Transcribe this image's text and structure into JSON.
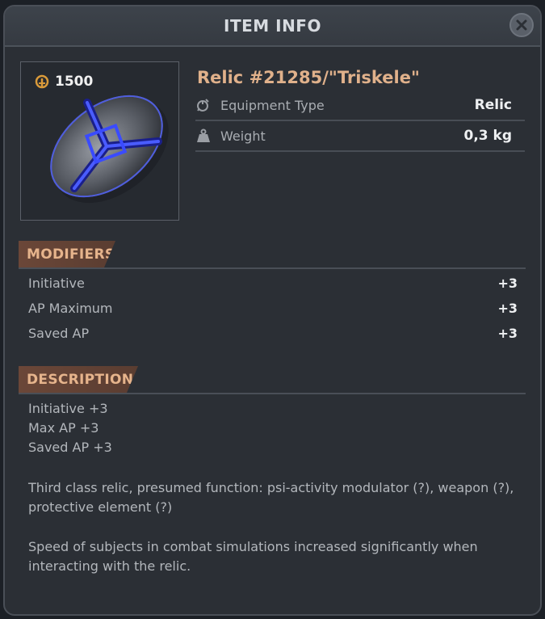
{
  "header": {
    "title": "ITEM INFO"
  },
  "item": {
    "price": "1500",
    "name": "Relic #21285/\"Triskele\"",
    "stats": [
      {
        "label": "Equipment Type",
        "value": "Relic",
        "icon": "equipment-type-icon"
      },
      {
        "label": "Weight",
        "value": "0,3 kg",
        "icon": "weight-icon"
      }
    ]
  },
  "modifiers": {
    "title": "MODIFIERS",
    "rows": [
      {
        "label": "Initiative",
        "value": "+3"
      },
      {
        "label": "AP Maximum",
        "value": "+3"
      },
      {
        "label": "Saved AP",
        "value": "+3"
      }
    ]
  },
  "description": {
    "title": "DESCRIPTION",
    "lines": [
      "Initiative +3",
      "Max AP +3",
      "Saved AP +3",
      "Third class relic, presumed function: psi-activity modulator (?), weapon (?),",
      "protective element (?)",
      "Speed of subjects in combat simulations increased significantly when",
      "interacting with the relic."
    ]
  },
  "colors": {
    "accent": "#e0b18b",
    "section_tab": "#6b4738",
    "price_icon": "#d99a3a"
  }
}
